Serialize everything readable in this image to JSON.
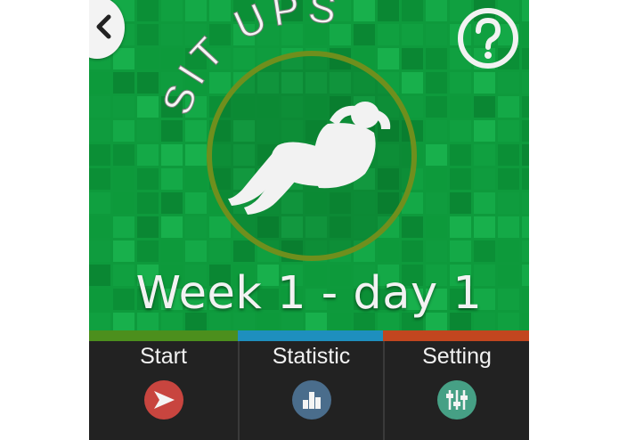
{
  "app": {
    "title": "SIT UPS",
    "progress_label": "Week 1 - day 1"
  },
  "header": {
    "back_icon": "chevron-left-icon",
    "help_icon": "question-mark-icon"
  },
  "nav": {
    "items": [
      {
        "label": "Start",
        "icon": "play-arrow-icon",
        "accent": "#4c8f1d",
        "icon_color": "#c8453f"
      },
      {
        "label": "Statistic",
        "icon": "bar-chart-icon",
        "accent": "#1e8fbe",
        "icon_color": "#4a6d8c"
      },
      {
        "label": "Setting",
        "icon": "sliders-icon",
        "accent": "#c2461f",
        "icon_color": "#46a085"
      }
    ]
  },
  "colors": {
    "hero_green": "#0e9a3c",
    "ring": "#6f8f1d",
    "nav_bg": "#222222"
  }
}
